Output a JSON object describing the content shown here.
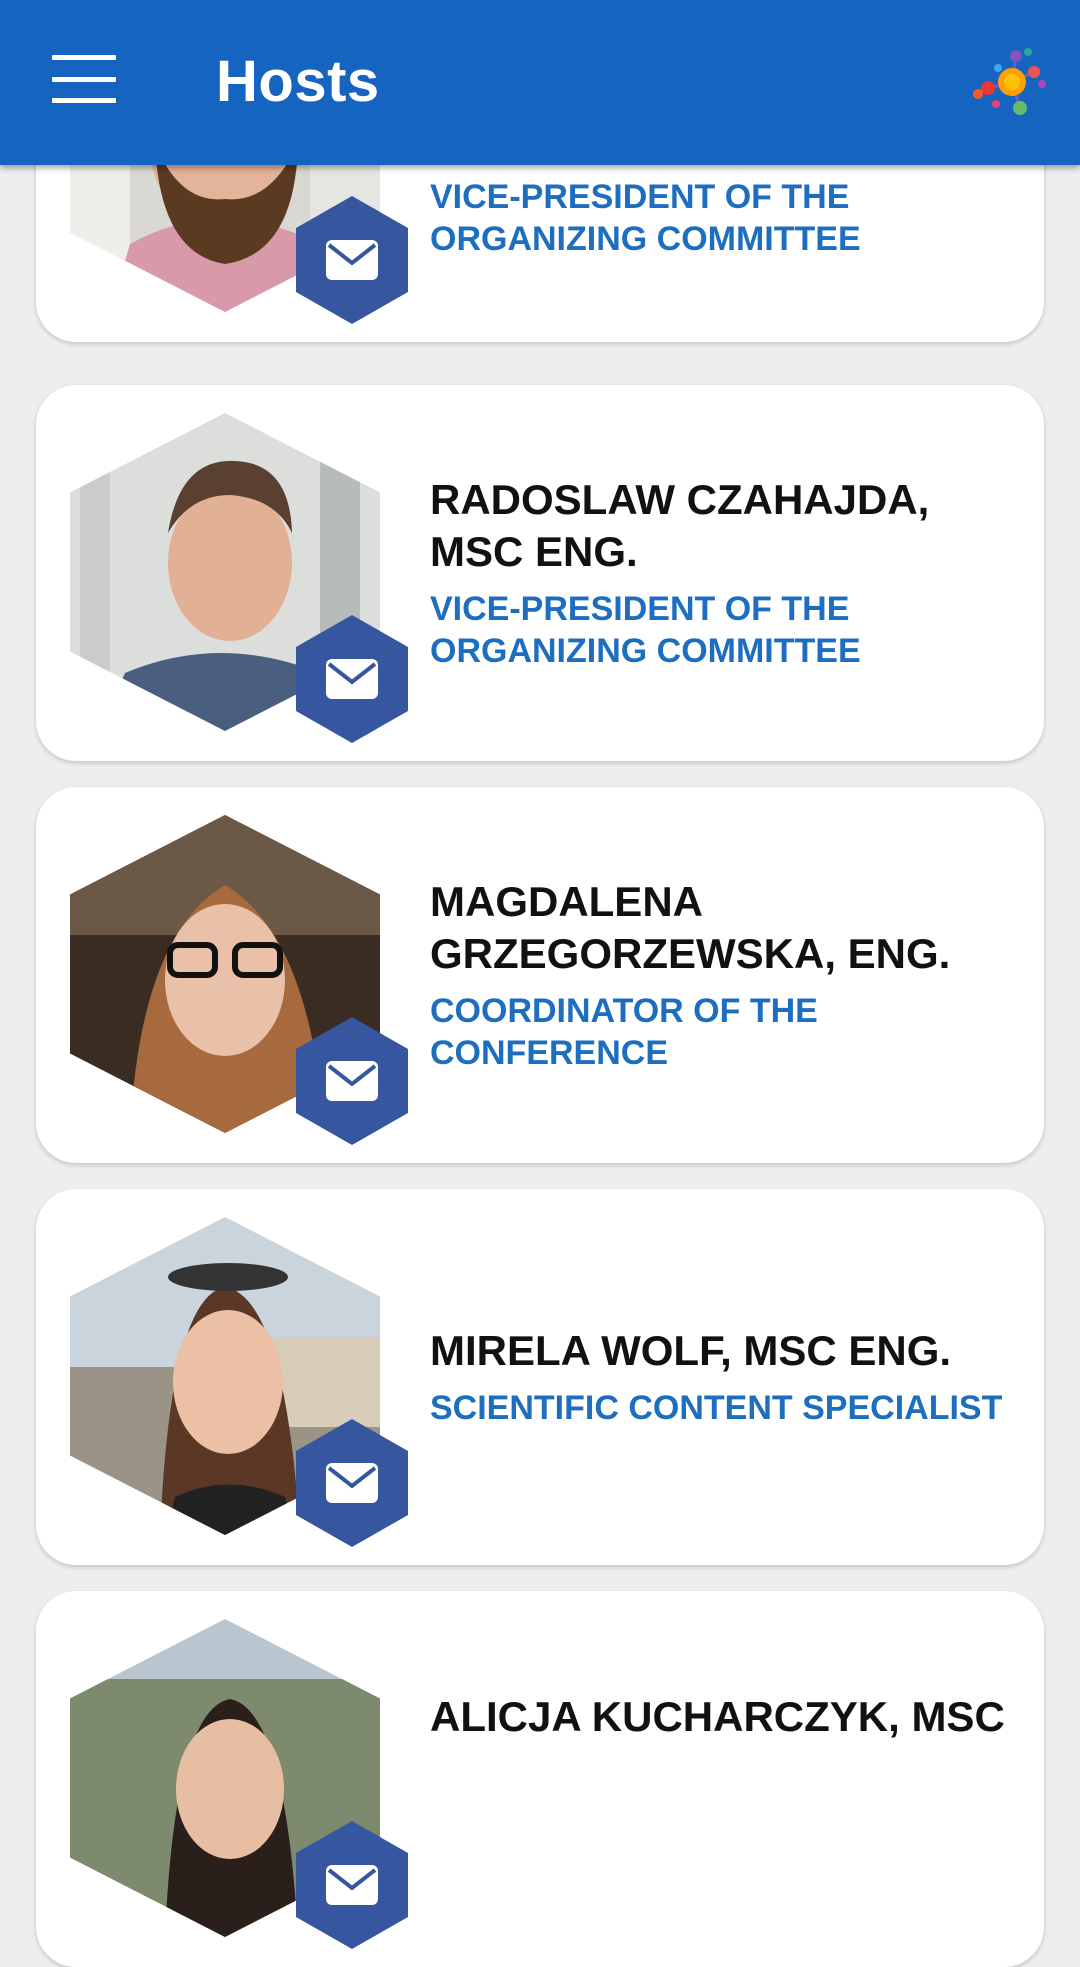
{
  "app": {
    "title": "Hosts",
    "menu_icon": "hamburger-menu-icon",
    "logo_icon": "molecule-logo-icon",
    "colors": {
      "appbar": "#1565c0",
      "accent_text": "#1e6ec0",
      "mail_hex": "#3657a0"
    }
  },
  "hosts": [
    {
      "name": "",
      "role": "VICE-PRESIDENT OF THE ORGANIZING COMMITTEE",
      "mail_icon": "envelope-icon"
    },
    {
      "name": "RADOSLAW CZAHAJDA, MSC ENG.",
      "role": "VICE-PRESIDENT OF THE ORGANIZING COMMITTEE",
      "mail_icon": "envelope-icon"
    },
    {
      "name": "MAGDALENA GRZEGORZEWSKA, ENG.",
      "role": "COORDINATOR OF THE CONFERENCE",
      "mail_icon": "envelope-icon"
    },
    {
      "name": "MIRELA WOLF, MSC ENG.",
      "role": "SCIENTIFIC CONTENT SPECIALIST",
      "mail_icon": "envelope-icon"
    },
    {
      "name": "ALICJA KUCHARCZYK, MSC",
      "role": "",
      "mail_icon": "envelope-icon"
    }
  ]
}
